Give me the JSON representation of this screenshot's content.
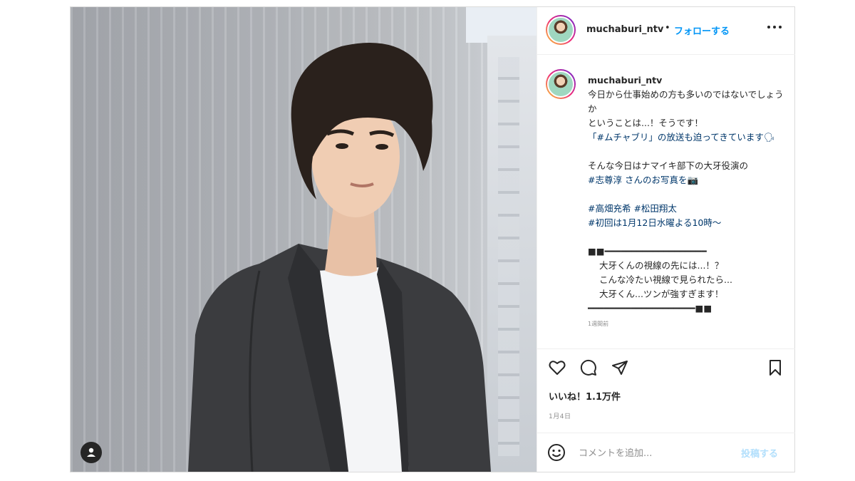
{
  "header": {
    "username": "muchaburi_ntv",
    "separator": "•",
    "follow_label": "フォローする",
    "more_icon": "more-horizontal-icon"
  },
  "caption": {
    "username": "muchaburi_ntv",
    "lines": [
      "今日から仕事始めの方も多いのではないでしょうか",
      "ということは...！そうです！",
      "「#ムチャブリ」の放送も迫ってきています🗣",
      "",
      "そんな今日はナマイキ部下の大牙役演の",
      "#志尊淳 さんのお写真を📷",
      "",
      "#高畑充希 #松田翔太",
      "#初回は1月12日水曜よる10時〜",
      "",
      "■■━━━━━━━━━━━━━━━━━━━",
      "大牙くんの視線の先には...！？",
      "こんな冷たい視線で見られたら...",
      "大牙くん...ツンが強すぎます！",
      "━━━━━━━━━━━━━━━━━━━━■■"
    ],
    "posted_ago": "1週間前"
  },
  "actions": {
    "like_icon": "heart-icon",
    "comment_icon": "comment-icon",
    "share_icon": "paper-plane-icon",
    "save_icon": "bookmark-icon"
  },
  "likes_text": "いいね！1.1万件",
  "date_text": "1月4日",
  "comment": {
    "emoji_icon": "smiley-icon",
    "placeholder": "コメントを追加...",
    "post_label": "投稿する"
  },
  "photo": {
    "user_tag_icon": "person-icon"
  },
  "colors": {
    "accent": "#0095f6",
    "post_disabled": "#b2dffc",
    "hashtag": "#00376b",
    "border": "#dbdbdb"
  }
}
